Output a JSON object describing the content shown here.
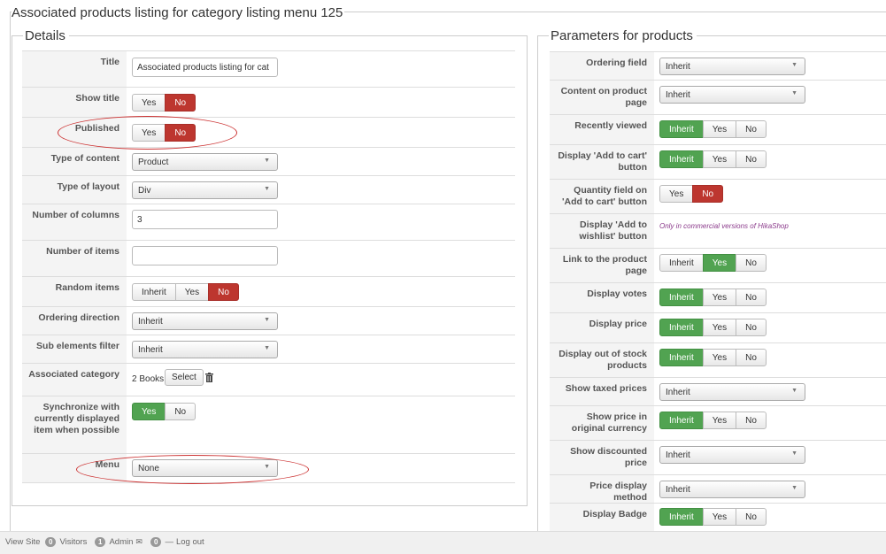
{
  "page_title": "Associated products listing for category listing menu 125",
  "details": {
    "legend": "Details",
    "rows": [
      {
        "label": "Title",
        "value": "Associated products listing for cat"
      },
      {
        "label": "Show title",
        "options": [
          "Yes",
          "No"
        ],
        "selected": "No"
      },
      {
        "label": "Published",
        "options": [
          "Yes",
          "No"
        ],
        "selected": "No"
      },
      {
        "label": "Type of content",
        "value": "Product"
      },
      {
        "label": "Type of layout",
        "value": "Div"
      },
      {
        "label": "Number of columns",
        "value": "3"
      },
      {
        "label": "Number of items",
        "value": ""
      },
      {
        "label": "Random items",
        "options": [
          "Inherit",
          "Yes",
          "No"
        ],
        "selected": "No"
      },
      {
        "label": "Ordering direction",
        "value": "Inherit"
      },
      {
        "label": "Sub elements filter",
        "value": "Inherit"
      },
      {
        "label": "Associated category",
        "value": "2 Books",
        "button": "Select"
      },
      {
        "label": "Synchronize with currently displayed item when possible",
        "options": [
          "Yes",
          "No"
        ],
        "selected": "Yes"
      },
      {
        "label": "Menu",
        "value": "None"
      }
    ]
  },
  "params": {
    "legend": "Parameters for products",
    "rows": [
      {
        "label": "Ordering field",
        "value": "Inherit"
      },
      {
        "label": "Content on product page",
        "value": "Inherit"
      },
      {
        "label": "Recently viewed",
        "options": [
          "Inherit",
          "Yes",
          "No"
        ],
        "selected": "Inherit"
      },
      {
        "label": "Display 'Add to cart' button",
        "options": [
          "Inherit",
          "Yes",
          "No"
        ],
        "selected": "Inherit"
      },
      {
        "label": "Quantity field on 'Add to cart' button",
        "options": [
          "Yes",
          "No"
        ],
        "selected": "No"
      },
      {
        "label": "Display 'Add to wishlist' button",
        "note": "Only in commercial versions of HikaShop"
      },
      {
        "label": "Link to the product page",
        "options": [
          "Inherit",
          "Yes",
          "No"
        ],
        "selected": "Yes"
      },
      {
        "label": "Display votes",
        "options": [
          "Inherit",
          "Yes",
          "No"
        ],
        "selected": "Inherit"
      },
      {
        "label": "Display price",
        "options": [
          "Inherit",
          "Yes",
          "No"
        ],
        "selected": "Inherit"
      },
      {
        "label": "Display out of stock products",
        "options": [
          "Inherit",
          "Yes",
          "No"
        ],
        "selected": "Inherit"
      },
      {
        "label": "Show taxed prices",
        "value": "Inherit"
      },
      {
        "label": "Show price in original currency",
        "options": [
          "Inherit",
          "Yes",
          "No"
        ],
        "selected": "Inherit"
      },
      {
        "label": "Show discounted price",
        "value": "Inherit"
      },
      {
        "label": "Price display method",
        "value": "Inherit"
      },
      {
        "label": "Display Badge",
        "options": [
          "Inherit",
          "Yes",
          "No"
        ],
        "selected": "Inherit"
      }
    ]
  },
  "status_bar": {
    "view_site": "View Site",
    "visitors_count": "0",
    "visitors_label": "Visitors",
    "admin_count": "1",
    "admin_label": "Admin",
    "messages_count": "0",
    "logout": "Log out"
  },
  "colors": {
    "selected_no": "#bd362f",
    "selected_yes": "#51a351",
    "annotation": "#cc3333"
  }
}
